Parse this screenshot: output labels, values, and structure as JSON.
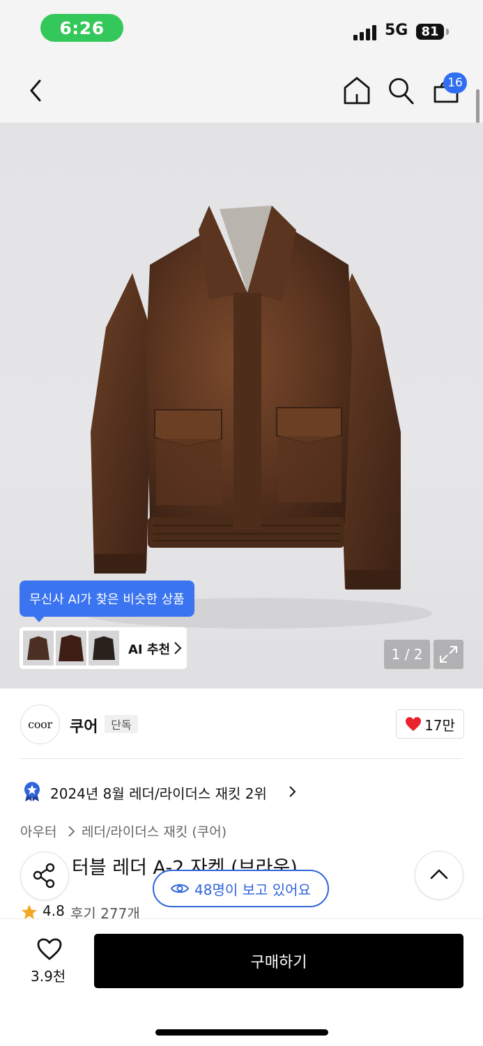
{
  "status_bar": {
    "time": "6:26",
    "network": "5G",
    "battery": "81"
  },
  "nav": {
    "cart_count": "16"
  },
  "gallery": {
    "ai_tooltip": "무신사 AI가 찾은 비슷한 상품",
    "ai_recommend_label": "AI 추천",
    "counter": "1 / 2"
  },
  "brand": {
    "logo_text": "coor",
    "name": "쿠어",
    "tag": "단독",
    "likes": "17만"
  },
  "ranking": {
    "text": "2024년 8월 레더/라이더스 재킷 2위"
  },
  "breadcrumb": {
    "category": "아우터",
    "subcategory": "레더/라이더스 재킷 (쿠어)"
  },
  "product": {
    "title_visible": "터블 레더 A-2 자켓 (브라운)"
  },
  "viewers": {
    "text": "48명이 보고 있어요"
  },
  "rating": {
    "value": "4.8",
    "reviews": "후기 277개"
  },
  "bottom_bar": {
    "wish_count": "3.9천",
    "buy_label": "구매하기"
  },
  "colors": {
    "accent_blue": "#2f6ef0",
    "heart_red": "#e8232e",
    "status_green": "#34c759",
    "star_orange": "#f5a623"
  }
}
